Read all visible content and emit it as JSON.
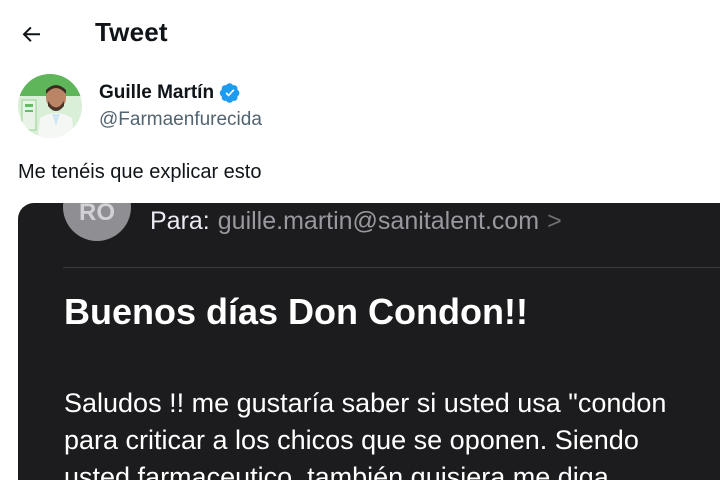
{
  "header": {
    "title": "Tweet",
    "back_icon": "arrow-left-icon"
  },
  "author": {
    "name": "Guille Martín",
    "handle": "@Farmaenfurecida",
    "verified_icon": "verified-badge-icon",
    "verified_color": "#1d9bf0"
  },
  "tweet": {
    "text": "Me tenéis que explicar esto"
  },
  "email": {
    "sender_initials": "RO",
    "to_label": "Para:",
    "to_address": "guille.martin@sanitalent.com",
    "to_chevron": ">",
    "subject": "Buenos días Don Condon!!",
    "body_lines": [
      "Saludos !! me gustaría saber si usted usa \"condon",
      "para criticar a los chicos que se oponen. Siendo",
      "usted farmaceutico, también quisiera me diga"
    ]
  },
  "colors": {
    "text_primary": "#0f1419",
    "text_secondary": "#536471",
    "email_background": "#1c1c1e",
    "accent": "#1d9bf0"
  }
}
